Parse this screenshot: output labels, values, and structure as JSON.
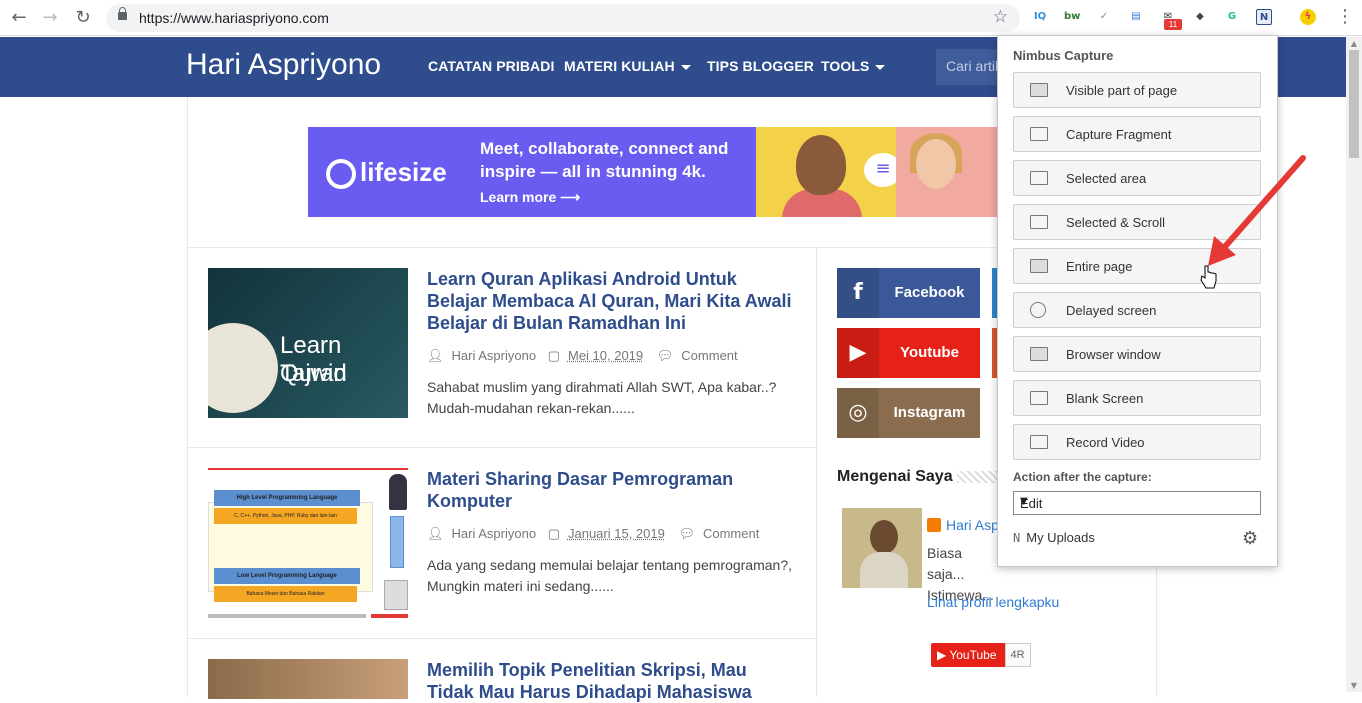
{
  "browser": {
    "url": "https://www.hariaspriyono.com",
    "back_glyph": "←",
    "forward_glyph": "→",
    "reload_glyph": "↻",
    "star_glyph": "☆",
    "menu_glyph": "⋮",
    "extensions": [
      {
        "name": "iq-extension-icon",
        "text": "IQ",
        "color": "#2b8fd6"
      },
      {
        "name": "bw-extension-icon",
        "text": "bw",
        "color": "#2c7a2c"
      },
      {
        "name": "check-extension-icon",
        "text": "✓",
        "color": "#888888"
      },
      {
        "name": "doc-extension-icon",
        "text": "▤",
        "color": "#3b78d8"
      },
      {
        "name": "mail-extension-icon",
        "text": "✉",
        "color": "#333333"
      },
      {
        "name": "shield-extension-icon",
        "text": "◆",
        "color": "#444444"
      },
      {
        "name": "grammarly-icon",
        "text": "G",
        "color": "#15c39a"
      },
      {
        "name": "nimbus-extension-icon",
        "text": "N",
        "color": "#2f4c8d"
      },
      {
        "name": "lightning-extension-icon",
        "text": "ϟ",
        "color": "#e53935"
      }
    ],
    "badge": "11"
  },
  "site": {
    "title": "Hari Aspriyono",
    "nav": [
      "CATATAN PRIBADI",
      "MATERI KULIAH",
      "TIPS BLOGGER",
      "TOOLS"
    ],
    "search_placeholder": "Cari artikel"
  },
  "ad": {
    "brand": "lifesize",
    "text": "Meet, collaborate, connect and inspire — all in stunning 4k.",
    "cta": "Learn more ⟶"
  },
  "posts": [
    {
      "title": "Learn Quran Aplikasi Android Untuk Belajar Membaca Al Quran, Mari Kita Awali Belajar di Bulan Ramadhan Ini",
      "thumb_text1": "Learn Quran",
      "thumb_text2": "Tajwid",
      "author": "Hari Aspriyono",
      "date": "Mei 10, 2019",
      "comment": "Comment",
      "excerpt": "Sahabat muslim yang dirahmati Allah SWT, Apa kabar..? Mudah-mudahan rekan-rekan......"
    },
    {
      "title": "Materi Sharing Dasar Pemrograman Komputer",
      "thumb_high": "High Level Programming Language",
      "thumb_high_sub": "C, C++, Python, Java, PHP, Ruby dan lain-lain",
      "thumb_low": "Low Level Programming Language",
      "thumb_low_sub": "Bahasa Mesin dan Bahasa Rakitan",
      "author": "Hari Aspriyono",
      "date": "Januari 15, 2019",
      "comment": "Comment",
      "excerpt": "Ada yang sedang memulai belajar tentang pemrograman?, Mungkin materi ini sedang......"
    },
    {
      "title": "Memilih Topik Penelitian Skripsi, Mau Tidak Mau Harus Dihadapi Mahasiswa"
    }
  ],
  "sidebar": {
    "social": [
      {
        "label": "Facebook",
        "icon": "f",
        "color": "#3b5998",
        "dark": "#344e86"
      },
      {
        "label": "Youtube",
        "icon": "▶",
        "color": "#e62117",
        "dark": "#c91c13"
      },
      {
        "label": "Instagram",
        "icon": "◎",
        "color": "#8a6d4f",
        "dark": "#7a6045"
      }
    ],
    "about_title": "Mengenai Saya",
    "about_name": "Hari Aspriyono",
    "about_text": "Biasa saja... Istimewa...",
    "about_link": "Lihat profil lengkapku",
    "yt_label": "YouTube",
    "yt_count": "4R"
  },
  "nimbus": {
    "title": "Nimbus Capture",
    "buttons": [
      "Visible part of page",
      "Capture Fragment",
      "Selected area",
      "Selected & Scroll",
      "Entire page",
      "Delayed screen",
      "Browser window",
      "Blank Screen",
      "Record Video"
    ],
    "action_label": "Action after the capture:",
    "action_value": "Edit",
    "uploads": "My Uploads",
    "accent_arrow_color": "#e53935"
  }
}
